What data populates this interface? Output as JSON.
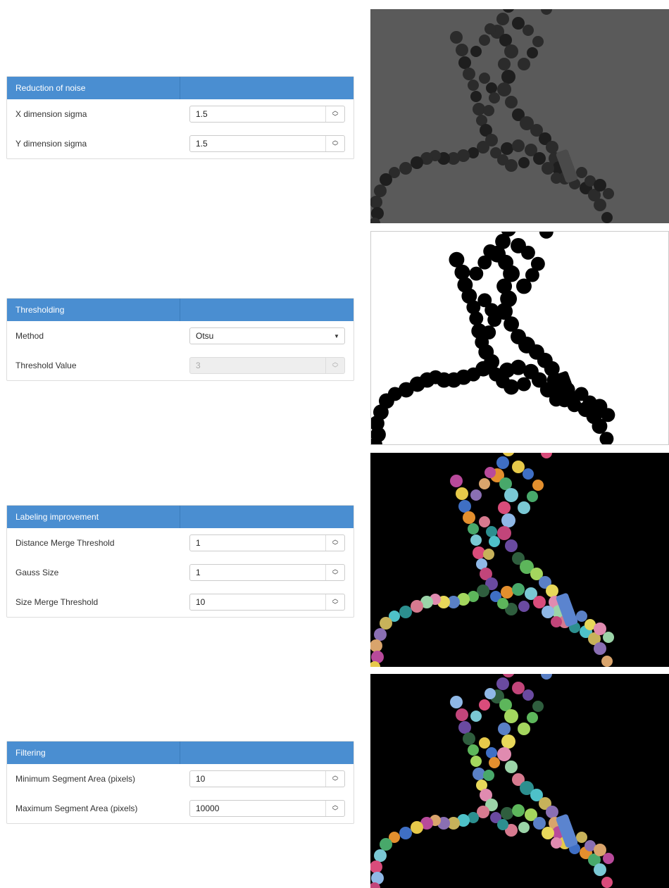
{
  "panels": {
    "noise": {
      "title": "Reduction of noise",
      "x_sigma_label": "X dimension sigma",
      "x_sigma_value": "1.5",
      "y_sigma_label": "Y dimension sigma",
      "y_sigma_value": "1.5"
    },
    "threshold": {
      "title": "Thresholding",
      "method_label": "Method",
      "method_value": "Otsu",
      "value_label": "Threshold Value",
      "value_value": "3"
    },
    "labeling": {
      "title": "Labeling improvement",
      "distance_label": "Distance Merge Threshold",
      "distance_value": "1",
      "gauss_label": "Gauss Size",
      "gauss_value": "1",
      "size_label": "Size Merge Threshold",
      "size_value": "10"
    },
    "filtering": {
      "title": "Filtering",
      "min_label": "Minimum Segment Area (pixels)",
      "min_value": "10",
      "max_label": "Maximum Segment Area (pixels)",
      "max_value": "10000"
    }
  },
  "icons": {
    "spinner": "up-down-chevrons",
    "dropdown": "caret-down"
  },
  "colors": {
    "header": "#4a8ed1",
    "grayscale_bg": "#5a5a5a",
    "binary_bg": "#ffffff",
    "label_bg": "#000000"
  }
}
